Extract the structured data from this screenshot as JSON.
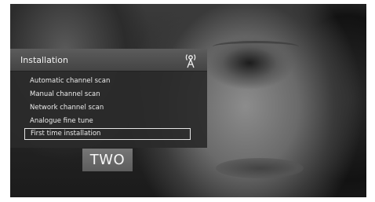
{
  "menu": {
    "title": "Installation",
    "icon": "antenna-icon",
    "items": [
      {
        "label": "Automatic channel scan"
      },
      {
        "label": "Manual channel scan"
      },
      {
        "label": "Network channel scan"
      },
      {
        "label": "Analogue fine tune"
      },
      {
        "label": "First time installation",
        "selected": true
      }
    ]
  },
  "channel_logo": {
    "text": "TWO"
  }
}
